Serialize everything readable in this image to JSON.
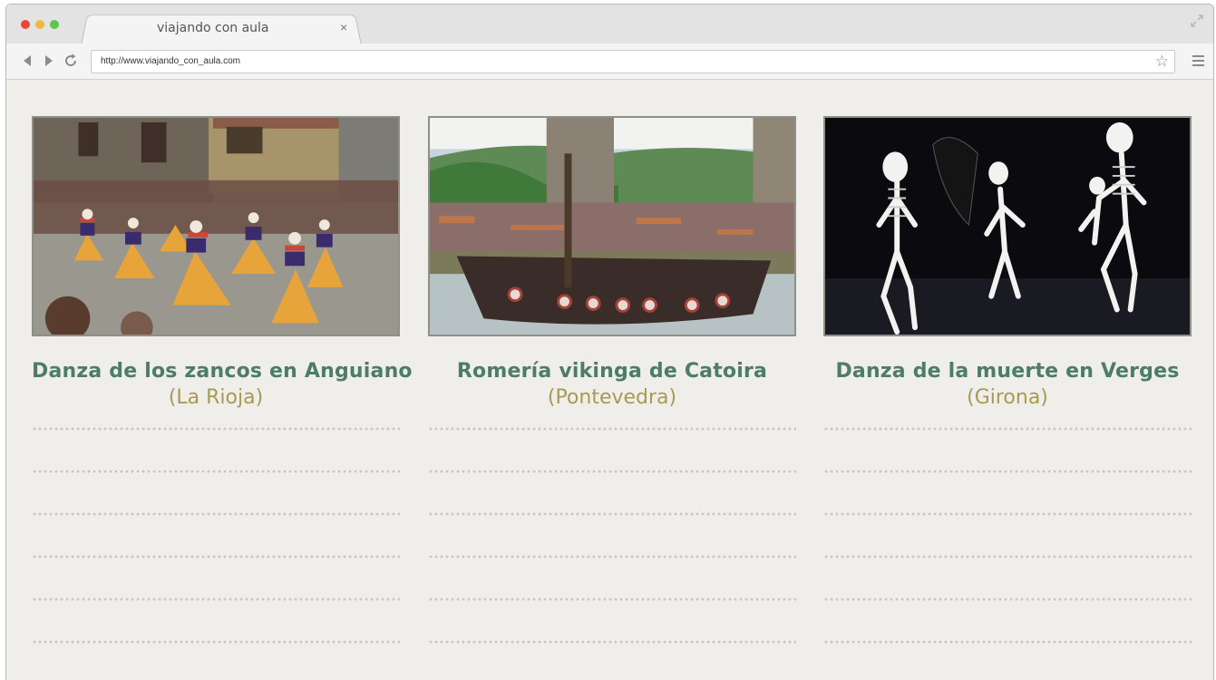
{
  "browser": {
    "tab_title": "viajando con aula",
    "tab_close": "×",
    "url": "http://www.viajando_con_aula.com",
    "star": "☆"
  },
  "cards": [
    {
      "title": "Danza de los zancos en Anguiano",
      "region": "(La Rioja)"
    },
    {
      "title": "Romería vikinga de Catoira",
      "region": "(Pontevedra)"
    },
    {
      "title": "Danza de la muerte en Verges",
      "region": "(Girona)"
    }
  ],
  "colors": {
    "title": "#4d7b6c",
    "region": "#a99a52",
    "page_background": "#efeeeb"
  }
}
